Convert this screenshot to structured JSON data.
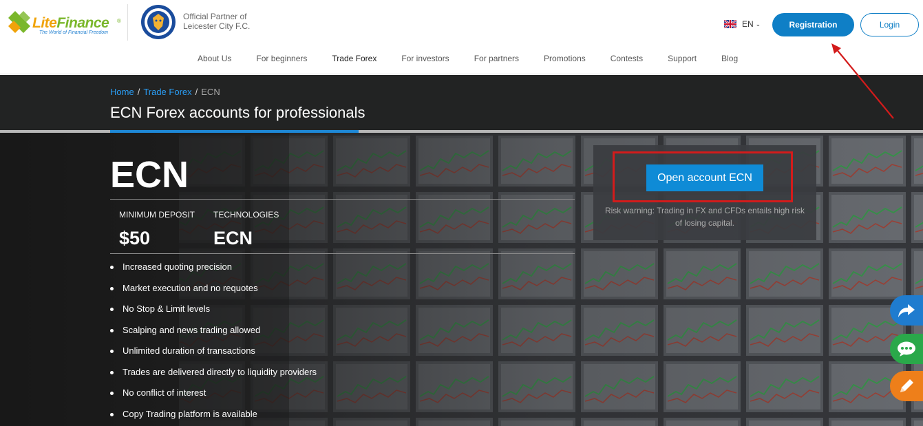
{
  "header": {
    "logo_text_lite": "Lite",
    "logo_text_finance": "Finance",
    "logo_tagline": "The World of Financial Freedom",
    "logo_reg": "®",
    "partner_line1": "Official Partner of",
    "partner_line2": "Leicester City F.C.",
    "language": "EN",
    "registration_label": "Registration",
    "login_label": "Login"
  },
  "nav": {
    "items": [
      "About Us",
      "For beginners",
      "Trade Forex",
      "For investors",
      "For partners",
      "Promotions",
      "Contests",
      "Support",
      "Blog"
    ],
    "active": "Trade Forex"
  },
  "breadcrumb": {
    "home": "Home",
    "sep1": "/",
    "trade_forex": "Trade Forex",
    "sep2": "/",
    "current": "ECN"
  },
  "page_title": "ECN Forex accounts for professionals",
  "hero": {
    "account_name": "ECN",
    "min_deposit_label": "MINIMUM DEPOSIT",
    "min_deposit_value": "$50",
    "technologies_label": "TECHNOLOGIES",
    "technologies_value": "ECN",
    "features": [
      "Increased quoting precision",
      "Market execution and no requotes",
      "No Stop & Limit levels",
      "Scalping and news trading allowed",
      "Unlimited duration of transactions",
      "Trades are delivered directly to liquidity providers",
      "No conflict of interest",
      "Copy Trading platform is available"
    ]
  },
  "cta": {
    "button_label": "Open account ECN",
    "risk_warning": "Risk warning: Trading in FX and CFDs entails high risk of losing capital."
  },
  "floating": {
    "share_icon": "share-arrow-icon",
    "chat_icon": "chat-bubble-icon",
    "edit_icon": "pencil-icon"
  },
  "colors": {
    "brand_blue": "#0f7fc6",
    "brand_green": "#7ab72b",
    "brand_orange": "#f0a30a",
    "annotation_red": "#d31b1b"
  }
}
